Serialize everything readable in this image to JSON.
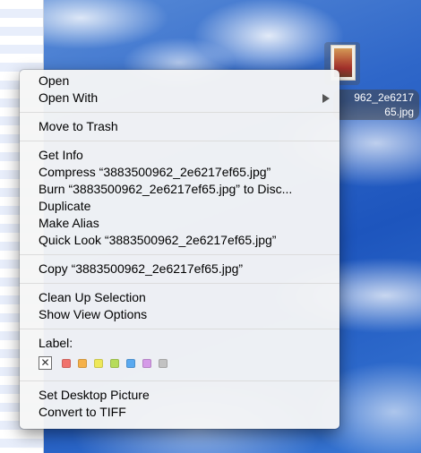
{
  "desktop_file": {
    "name_line1": "962_2e6217",
    "name_line2": "65.jpg"
  },
  "context_menu": {
    "items_group1": [
      {
        "label": "Open",
        "has_submenu": false
      },
      {
        "label": "Open With",
        "has_submenu": true
      }
    ],
    "items_group2": [
      {
        "label": "Move to Trash"
      }
    ],
    "items_group3": [
      {
        "label": "Get Info"
      },
      {
        "label": "Compress “3883500962_2e6217ef65.jpg”"
      },
      {
        "label": "Burn “3883500962_2e6217ef65.jpg” to Disc..."
      },
      {
        "label": "Duplicate"
      },
      {
        "label": "Make Alias"
      },
      {
        "label": "Quick Look “3883500962_2e6217ef65.jpg”"
      }
    ],
    "items_group4": [
      {
        "label": "Copy “3883500962_2e6217ef65.jpg”"
      }
    ],
    "items_group5": [
      {
        "label": "Clean Up Selection"
      },
      {
        "label": "Show View Options"
      }
    ],
    "label_section": {
      "title": "Label:",
      "clear_glyph": "✕",
      "colors": [
        {
          "name": "red",
          "hex": "#f0726c"
        },
        {
          "name": "orange",
          "hex": "#f5b14a"
        },
        {
          "name": "yellow",
          "hex": "#eee85a"
        },
        {
          "name": "green",
          "hex": "#b6dc5a"
        },
        {
          "name": "blue",
          "hex": "#5aa9f0"
        },
        {
          "name": "purple",
          "hex": "#d59ae8"
        },
        {
          "name": "gray",
          "hex": "#c2c2c2"
        }
      ]
    },
    "items_group6": [
      {
        "label": "Set Desktop Picture"
      },
      {
        "label": "Convert to TIFF"
      }
    ]
  }
}
